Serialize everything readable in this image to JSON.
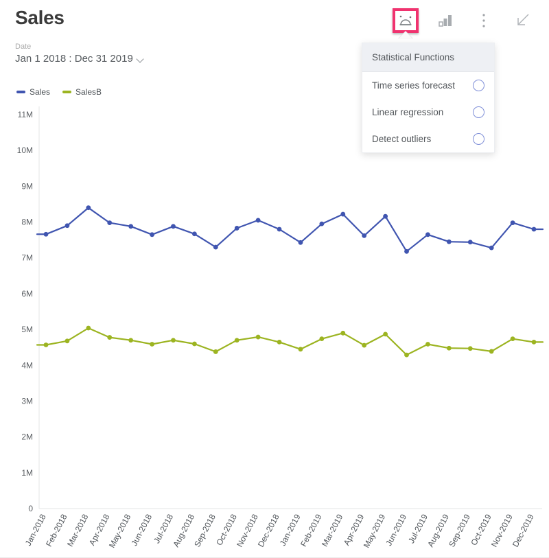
{
  "header": {
    "title": "Sales",
    "date_label": "Date",
    "date_value": "Jan 1 2018 : Dec 31 2019",
    "chevron_icon": "chevron-down-icon"
  },
  "toolbar": {
    "items": [
      {
        "name": "statistical-functions-icon",
        "label": "Statistical Functions",
        "active": true
      },
      {
        "name": "chart-type-icon",
        "label": "Chart type",
        "active": false
      },
      {
        "name": "more-options-icon",
        "label": "More options",
        "active": false
      },
      {
        "name": "collapse-icon",
        "label": "Collapse",
        "active": false
      }
    ],
    "active_accent": "#f0336f"
  },
  "menu": {
    "header": "Statistical Functions",
    "items": [
      {
        "label": "Time series forecast",
        "toggle": "off"
      },
      {
        "label": "Linear regression",
        "toggle": "off"
      },
      {
        "label": "Detect outliers",
        "toggle": "off"
      }
    ]
  },
  "legend": {
    "items": [
      {
        "label": "Sales",
        "color": "#4055b0"
      },
      {
        "label": "SalesB",
        "color": "#9cb421"
      }
    ]
  },
  "chart_data": {
    "type": "line",
    "title": "Sales",
    "xlabel": "",
    "ylabel": "",
    "ylim": [
      0,
      11000000
    ],
    "grid": false,
    "legend_position": "top-left",
    "ytick_labels": [
      "11M",
      "10M",
      "9M",
      "8M",
      "7M",
      "6M",
      "5M",
      "4M",
      "3M",
      "2M",
      "1M",
      "0"
    ],
    "ytick_values": [
      11000000,
      10000000,
      9000000,
      8000000,
      7000000,
      6000000,
      5000000,
      4000000,
      3000000,
      2000000,
      1000000,
      0
    ],
    "categories": [
      "Jan-2018",
      "Feb-2018",
      "Mar-2018",
      "Apr-2018",
      "May-2018",
      "Jun-2018",
      "Jul-2018",
      "Aug-2018",
      "Sep-2018",
      "Oct-2018",
      "Nov-2018",
      "Dec-2018",
      "Jan-2019",
      "Feb-2019",
      "Mar-2019",
      "Apr-2019",
      "May-2019",
      "Jun-2019",
      "Jul-2019",
      "Aug-2019",
      "Sep-2019",
      "Oct-2019",
      "Nov-2019",
      "Dec-2019"
    ],
    "series": [
      {
        "name": "Sales",
        "color": "#4055b0",
        "values": [
          7660000,
          7900000,
          8400000,
          7980000,
          7880000,
          7650000,
          7880000,
          7670000,
          7300000,
          7830000,
          8050000,
          7800000,
          7430000,
          7950000,
          8220000,
          7620000,
          8160000,
          7180000,
          7650000,
          7450000,
          7440000,
          7280000,
          7980000,
          7800000
        ]
      },
      {
        "name": "SalesB",
        "color": "#9cb421",
        "values": [
          4570000,
          4680000,
          5040000,
          4780000,
          4700000,
          4590000,
          4700000,
          4600000,
          4380000,
          4700000,
          4790000,
          4650000,
          4450000,
          4740000,
          4900000,
          4560000,
          4870000,
          4290000,
          4590000,
          4480000,
          4470000,
          4390000,
          4740000,
          4650000
        ]
      }
    ]
  }
}
